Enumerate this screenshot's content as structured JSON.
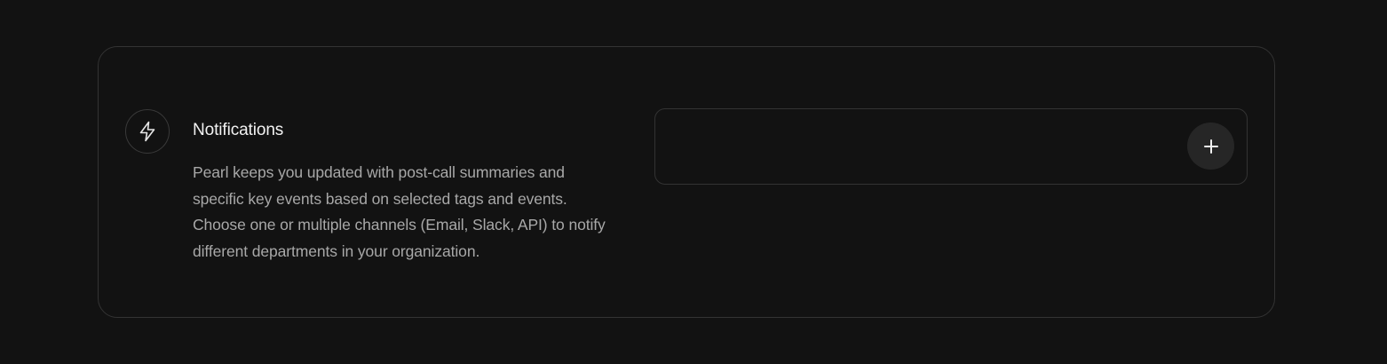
{
  "section": {
    "icon": "lightning-bolt-icon",
    "title": "Notifications",
    "description": "Pearl keeps you updated with post-call summaries and specific key events based on selected tags and events. Choose one or multiple channels (Email, Slack, API) to notify different departments in your organization."
  },
  "channels": {
    "add_icon": "plus-icon"
  },
  "colors": {
    "background": "#121212",
    "border": "#333333",
    "title_text": "#f2f2f2",
    "body_text": "#a8a8a8",
    "button_bg": "#262626"
  }
}
